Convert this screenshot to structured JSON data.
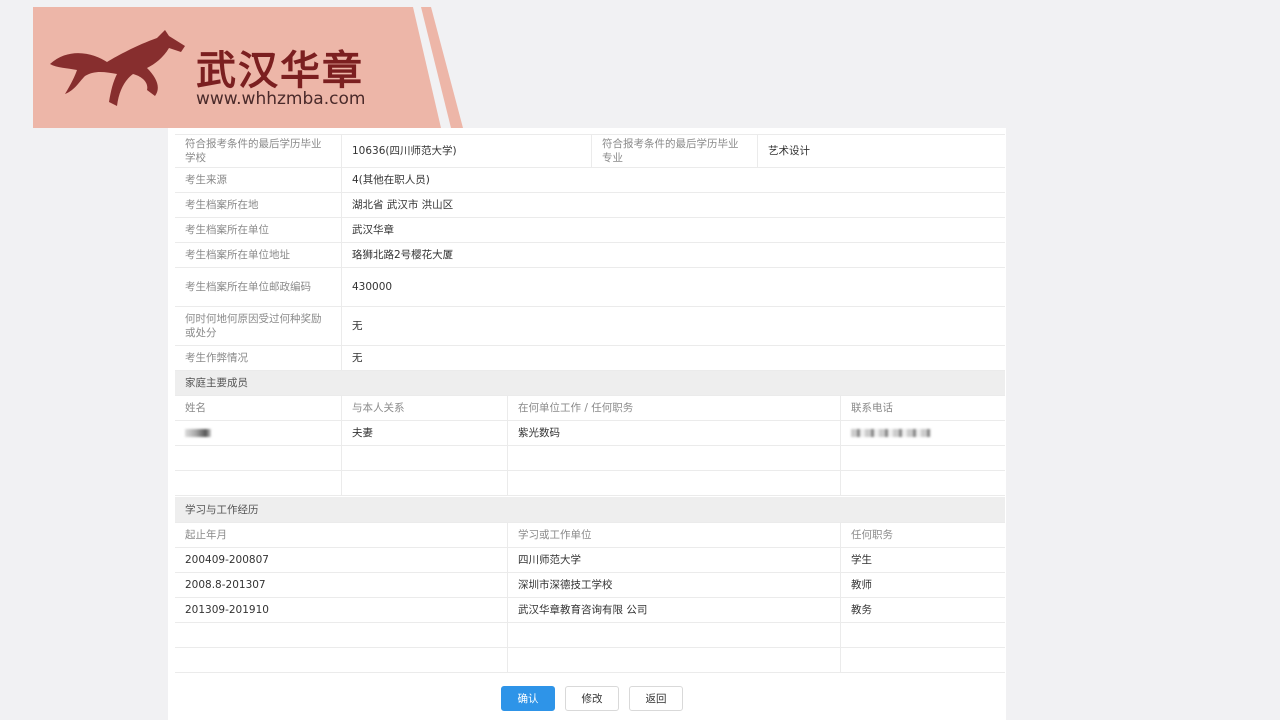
{
  "brand": {
    "name": "武汉华章",
    "url": "www.whhzmba.com",
    "color": "#7b1f20",
    "bg": "#edb6a8"
  },
  "info_rows": [
    {
      "label": "符合报考条件的最后学历毕业学校",
      "value": "10636(四川师范大学)",
      "label2": "符合报考条件的最后学历毕业专业",
      "value2": "艺术设计"
    },
    {
      "label": "考生来源",
      "value": "4(其他在职人员)"
    },
    {
      "label": "考生档案所在地",
      "value": "湖北省 武汉市 洪山区"
    },
    {
      "label": "考生档案所在单位",
      "value": "武汉华章"
    },
    {
      "label": "考生档案所在单位地址",
      "value": "珞狮北路2号樱花大厦"
    },
    {
      "label": "考生档案所在单位邮政编码",
      "value": "430000"
    },
    {
      "label": "何时何地何原因受过何种奖励或处分",
      "value": "无"
    },
    {
      "label": "考生作弊情况",
      "value": "无"
    }
  ],
  "family": {
    "title": "家庭主要成员",
    "headers": [
      "姓名",
      "与本人关系",
      "在何单位工作 / 任何职务",
      "联系电话"
    ],
    "rows": [
      {
        "relation": "夫妻",
        "work": "紫光数码"
      }
    ]
  },
  "history": {
    "title": "学习与工作经历",
    "headers": [
      "起止年月",
      "学习或工作单位",
      "任何职务"
    ],
    "rows": [
      {
        "period": "200409-200807",
        "unit": "四川师范大学",
        "role": "学生"
      },
      {
        "period": "2008.8-201307",
        "unit": "深圳市深德技工学校",
        "role": "教师"
      },
      {
        "period": "201309-201910",
        "unit": "武汉华章教育咨询有限 公司",
        "role": "教务"
      }
    ]
  },
  "buttons": {
    "confirm": "确认",
    "modify": "修改",
    "back": "返回"
  },
  "colors": {
    "primary": "#2e94e8",
    "section_bg": "#eeeeee"
  }
}
